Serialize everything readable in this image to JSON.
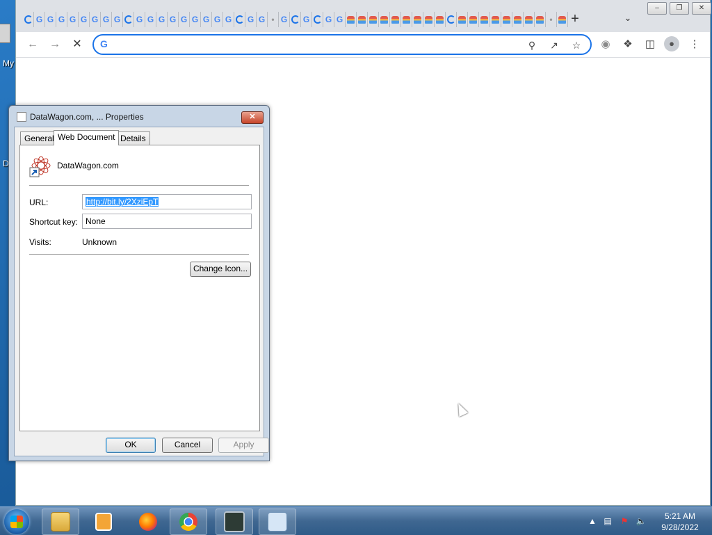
{
  "desktop": {
    "icon_label_partial": "My",
    "side_letter": "D"
  },
  "browser": {
    "new_tab_icon": "plus-icon",
    "tab_search_icon": "chevron-down-icon",
    "window_controls": {
      "minimize": "minimize-icon",
      "restore": "restore-icon",
      "close": "close-icon"
    },
    "omnibox": {
      "value": "",
      "search_provider_icon": "google-g-icon"
    },
    "toolbar_icons": [
      "back-icon",
      "forward-icon",
      "stop-icon",
      "zoom-icon",
      "share-icon",
      "bookmark-star-icon",
      "extension-shield-icon",
      "extensions-puzzle-icon",
      "side-panel-icon",
      "profile-icon",
      "menu-kebab-icon"
    ]
  },
  "dialog": {
    "title": "DataWagon.com, ... Properties",
    "tabs": [
      "General",
      "Web Document",
      "Details"
    ],
    "active_tab": "Web Document",
    "site_name": "DataWagon.com",
    "url_label": "URL:",
    "url_value": "http://bit.ly/2XziEpT",
    "shortcut_label": "Shortcut key:",
    "shortcut_value": "None",
    "visits_label": "Visits:",
    "visits_value": "Unknown",
    "change_icon_button": "Change Icon...",
    "ok_button": "OK",
    "cancel_button": "Cancel",
    "apply_button": "Apply"
  },
  "taskbar": {
    "items": [
      "start-orb",
      "explorer-icon",
      "media-player-icon",
      "firefox-icon",
      "chrome-icon",
      "task-manager-icon",
      "control-panel-icon"
    ],
    "clock_time": "5:21 AM",
    "clock_date": "9/28/2022",
    "tray_icons": [
      "show-hidden-icons-arrow",
      "network-icon",
      "action-center-flag-icon",
      "volume-icon"
    ]
  }
}
